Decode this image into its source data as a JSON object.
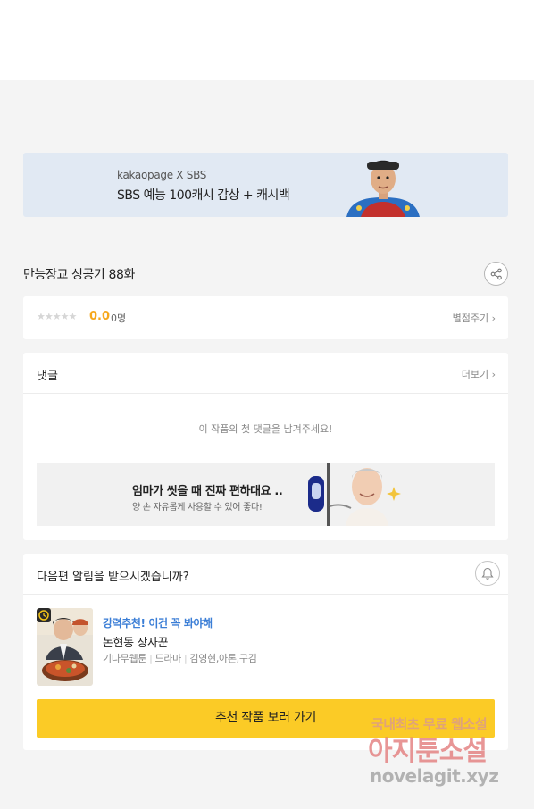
{
  "banner": {
    "brand": "kakaopage X SBS",
    "title": "SBS 예능 100캐시 감상 + 캐시백"
  },
  "episode": {
    "title": "만능장교 성공기 88화"
  },
  "rating": {
    "stars": "★★★★★",
    "score": "0.0",
    "count": "0명",
    "rate_label": "별점주기 ›"
  },
  "comments": {
    "title": "댓글",
    "more_label": "더보기 ›",
    "empty_text": "이 작품의 첫 댓글을 남겨주세요!",
    "ad": {
      "title": "엄마가 씻을 때 진짜 편하대요 ..",
      "subtitle": "양 손 자유롭게 사용할 수 있어 좋다!"
    }
  },
  "notify": {
    "question": "다음편 알림을 받으시겠습니까?",
    "recommend": {
      "tag": "강력추천! 이건 꼭 봐야해",
      "title": "논현동 장사꾼",
      "meta": [
        "기다무웹툰",
        "드라마",
        "김영현,아론,구김"
      ],
      "button_label": "추천 작품 보러 가기"
    }
  },
  "watermark": {
    "line1": "국내최초 무료 웹소설",
    "line2": "아지툰소설",
    "line3": "novelagit.xyz"
  },
  "colors": {
    "accent_yellow": "#fbcb26",
    "score_orange": "#f6a81c",
    "tag_blue": "#3b7ed6",
    "banner_bg": "#e1e9f3",
    "page_bg": "#f4f4f4"
  }
}
